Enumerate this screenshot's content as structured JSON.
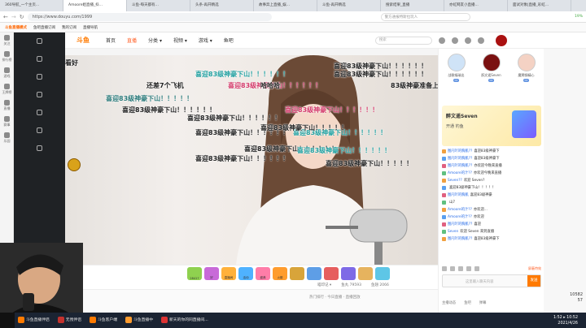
{
  "browser": {
    "tabs": [
      {
        "label": "360导航_一个主页...",
        "active": false
      },
      {
        "label": "Amoore姐直播_抖...",
        "active": true
      },
      {
        "label": "斗鱼-每天都有...",
        "active": false
      },
      {
        "label": "头条-再开精选",
        "active": false
      },
      {
        "label": "故事奔上直播_娱...",
        "active": false
      },
      {
        "label": "斗鱼-再开精选",
        "active": false
      },
      {
        "label": "搜索结果_直播",
        "active": false
      },
      {
        "label": "亦虹网友小直播...",
        "active": false
      },
      {
        "label": "面试对象|直播_彩虹...",
        "active": false
      }
    ],
    "url": "https://www.douyu.com/1999",
    "search_placeholder": "警方通报特斯拉玩人",
    "zoom": "19%"
  },
  "bookmarks": {
    "logo": "斗鱼直播模式",
    "items": [
      "鱼吧直播订阅",
      "我的订阅",
      "直播导航"
    ]
  },
  "leftnav": {
    "items": [
      "关注",
      "排行榜",
      "游戏",
      "王牌榜",
      "直播",
      "赛事",
      "乐园"
    ]
  },
  "header": {
    "logo": "斗鱼",
    "nav": [
      "首页",
      "直播",
      "分类 ▾",
      "视频 ▾",
      "游戏 ▾",
      "鱼吧"
    ],
    "search_placeholder": "搜索"
  },
  "danmaku": [
    {
      "text": "喜迎83级神豪下山！！！！！！",
      "color": "#222"
    },
    {
      "text": "喜迎83级神豪下山！！！！！！",
      "color": "#222"
    },
    {
      "text": "喜迎83级神豪下山！！！！！！",
      "color": "#22a0a0"
    },
    {
      "text": "喜迎83级神豪下山！！！！！！",
      "color": "#d33a6a"
    },
    {
      "text": "还差7个飞机",
      "color": "#222"
    },
    {
      "text": "哈哈哈",
      "color": "#222"
    },
    {
      "text": "83级神豪准备上",
      "color": "#222"
    },
    {
      "text": "喜迎83级神豪下山！！！！！",
      "color": "#2b7a7a"
    },
    {
      "text": "喜迎83级神豪下山！！！！！！",
      "color": "#222"
    },
    {
      "text": "喜迎83级神豪下山！！！！！！",
      "color": "#d33a6a"
    },
    {
      "text": "喜迎83级神豪下山！！！！！！",
      "color": "#222"
    },
    {
      "text": "喜迎83级神豪下山！！！！！！",
      "color": "#222"
    },
    {
      "text": "喜迎83级神豪下山！！！！！！",
      "color": "#22a0a0"
    },
    {
      "text": "喜迎83级神豪下山！！！！！！",
      "color": "#222"
    },
    {
      "text": "喜迎83级神豪下山！！！！！！",
      "color": "#222"
    },
    {
      "text": "喜迎83级神豪下山！！！！！！",
      "color": "#22a0a0"
    },
    {
      "text": "喜迎83级神豪下山！！！！！",
      "color": "#222"
    },
    {
      "text": "喜迎83级神豪下山！！！！！",
      "color": "#222"
    },
    {
      "text": "看好",
      "color": "#222"
    }
  ],
  "gifts": [
    {
      "label": "28417",
      "color": "#8fd14f"
    },
    {
      "label": "好",
      "color": "#c86ad8"
    },
    {
      "label": "直播间",
      "color": "#ffb13b"
    },
    {
      "label": "活动",
      "color": "#4fb2ff"
    },
    {
      "label": "盛典",
      "color": "#ff7da8"
    },
    {
      "label": "火箭",
      "color": "#ff9c2e"
    },
    {
      "label": "",
      "color": "#d8a43a"
    },
    {
      "label": "",
      "color": "#5e9ee6"
    },
    {
      "label": "",
      "color": "#e65e5e"
    },
    {
      "label": "",
      "color": "#7e6ae6"
    },
    {
      "label": "",
      "color": "#e6b35e"
    },
    {
      "label": "",
      "color": "#5ec6e6"
    }
  ],
  "stats": {
    "a": "喵印记 ▾",
    "b": "鱼丸 79593",
    "c": "鱼翅 2066"
  },
  "rightpanel": {
    "ranks": [
      {
        "name": "战歌福瑞出",
        "level": "LV"
      },
      {
        "name": "醉文遥Seven",
        "level": "LV"
      },
      {
        "name": "魔羯钢精心",
        "level": "LV"
      }
    ],
    "fan": {
      "title": "醉文遥Seven",
      "subtitle": "开通  钓鱼"
    },
    "chat": [
      {
        "user": "图闪吖的胸肌??",
        "text": "喜迎83级神豪下"
      },
      {
        "user": "图闪吖的胸肌??",
        "text": "喜迎83级神豪下"
      },
      {
        "user": "图闪吖的胸肌??",
        "text": "亦欢迎今晚来直播"
      },
      {
        "user": "Amoore的汁??",
        "text": "亦欢迎今晚来直播"
      },
      {
        "user": "Seven??",
        "text": "欢迎 Seven?"
      },
      {
        "user": "",
        "text": "喜迎83级神豪下山！！！！！"
      },
      {
        "user": "图闪吖的胸肌",
        "text": "喜迎83级神豪"
      },
      {
        "user": "",
        "text": "山7"
      },
      {
        "user": "Amoore的汁??",
        "text": "亦欢迎..."
      },
      {
        "user": "Amoore的汁??",
        "text": "亦欢迎"
      },
      {
        "user": "图闪吖的胸肌??",
        "text": "喜迎"
      },
      {
        "user": "Seven",
        "text": "欢迎 Seven 来到直播"
      },
      {
        "user": "图闪吖的胸肌??",
        "text": "喜迎83级神豪下"
      }
    ],
    "input_placeholder": "这里输入聊天内容",
    "send_label": "发送",
    "tool_right": "屏蔽特效",
    "bottom": [
      "主播动态",
      "鱼吧",
      "弹幕"
    ]
  },
  "bottominfo": "热门排行  ·  今日直播  ·  直播回放",
  "taskbar": {
    "items": [
      {
        "label": "斗鱼直播伴侣",
        "color": "#ff7a00"
      },
      {
        "label": "无畏伴侣",
        "color": "#c3322e"
      },
      {
        "label": "斗鱼客户端",
        "color": "#ff7a00"
      },
      {
        "label": "斗鱼直播中",
        "color": "#ff9c2e"
      },
      {
        "label": "新天的你的同直播间...",
        "color": "#d33"
      }
    ],
    "time": "1:52 ▸ 10:52",
    "date": "2021/4/26"
  },
  "overlay": {
    "views": "10582",
    "rank": "57"
  }
}
